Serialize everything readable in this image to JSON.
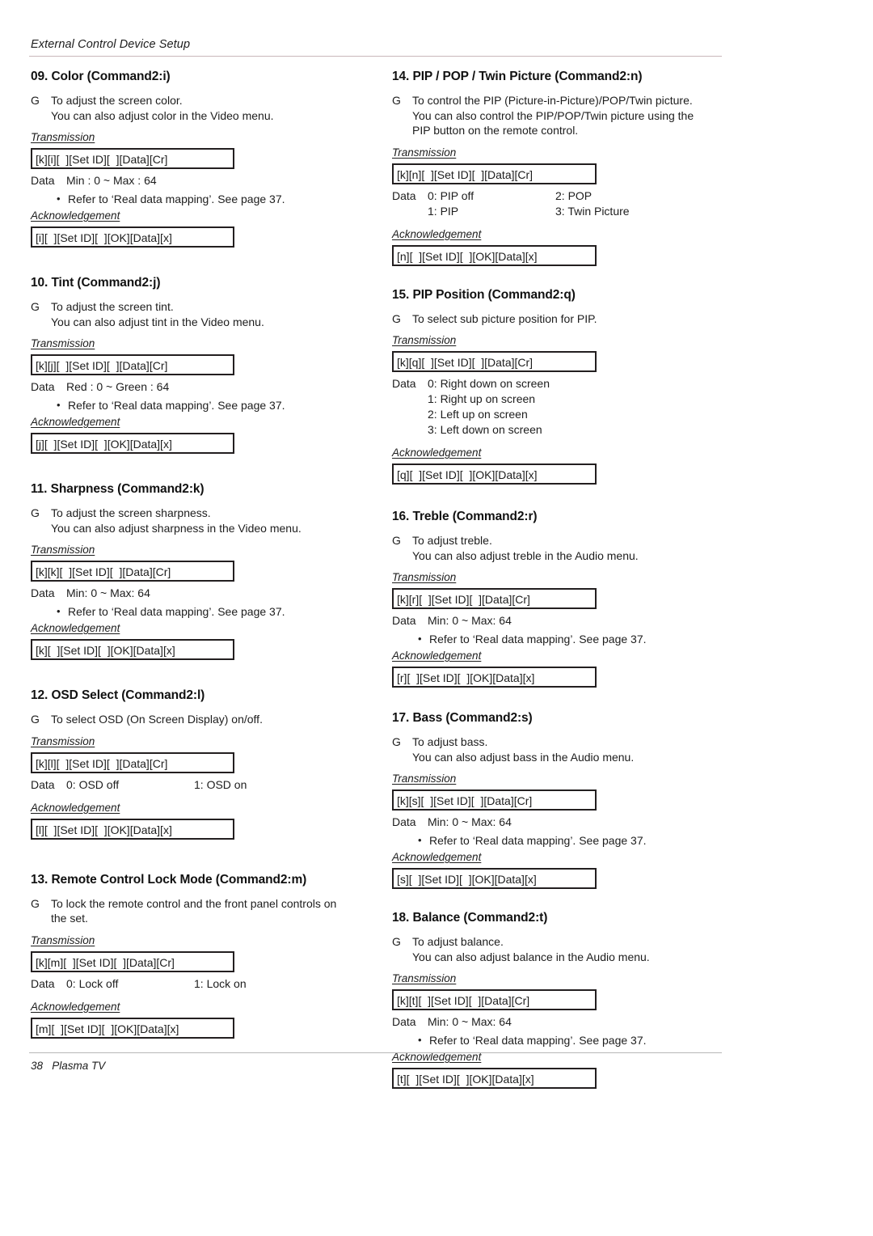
{
  "header": {
    "running_title": "External Control Device Setup"
  },
  "footer": {
    "page_number": "38",
    "product": "Plasma TV",
    "text": "38   Plasma TV"
  },
  "labels": {
    "transmission": "Transmission",
    "acknowledgement": "Acknowledgement",
    "data": "Data",
    "gmark": "G",
    "bullet": "•",
    "note_refer": "Refer to ‘Real data mapping’. See page 37."
  },
  "left_column": [
    {
      "id": "sec-09-color",
      "title": "09. Color (Command2:i)",
      "desc_lines": [
        "To adjust the screen color.",
        "You can also adjust color in the Video menu."
      ],
      "transmission": "[k][i][  ][Set ID][  ][Data][Cr]",
      "data_label": "Data",
      "data_values": [
        "Min : 0 ~ Max : 64"
      ],
      "data_values_col2": [],
      "note": "Refer to ‘Real data mapping’. See page 37.",
      "acknowledgement": "[i][  ][Set ID][  ][OK][Data][x]"
    },
    {
      "id": "sec-10-tint",
      "title": "10. Tint (Command2:j)",
      "desc_lines": [
        "To adjust the screen tint.",
        "You can also adjust tint in the Video menu."
      ],
      "transmission": "[k][j][  ][Set ID][  ][Data][Cr]",
      "data_label": "Data",
      "data_values": [
        "Red : 0 ~ Green : 64"
      ],
      "data_values_col2": [],
      "note": "Refer to ‘Real data mapping’. See page 37.",
      "acknowledgement": "[j][  ][Set ID][  ][OK][Data][x]"
    },
    {
      "id": "sec-11-sharpness",
      "title": "11. Sharpness (Command2:k)",
      "desc_lines": [
        "To adjust the screen sharpness.",
        "You can also adjust sharpness in the Video menu."
      ],
      "transmission": "[k][k][  ][Set ID][  ][Data][Cr]",
      "data_label": "Data",
      "data_values": [
        "Min: 0 ~ Max: 64"
      ],
      "data_values_col2": [],
      "note": "Refer to ‘Real data mapping’. See page 37.",
      "acknowledgement": "[k][  ][Set ID][  ][OK][Data][x]"
    },
    {
      "id": "sec-12-osd-select",
      "title": "12. OSD Select (Command2:l)",
      "desc_lines": [
        "To select OSD (On Screen Display) on/off."
      ],
      "transmission": "[k][l][  ][Set ID][  ][Data][Cr]",
      "data_label": "Data",
      "data_values": [
        "0: OSD off"
      ],
      "data_values_col2": [
        "1: OSD on"
      ],
      "note": "",
      "acknowledgement": "[l][  ][Set ID][  ][OK][Data][x]"
    },
    {
      "id": "sec-13-remote-lock",
      "title": "13. Remote Control Lock Mode (Command2:m)",
      "desc_lines": [
        "To lock the remote control and the front panel controls on",
        "the set."
      ],
      "transmission": "[k][m][  ][Set ID][  ][Data][Cr]",
      "data_label": "Data",
      "data_values": [
        "0: Lock off"
      ],
      "data_values_col2": [
        "1: Lock on"
      ],
      "note": "",
      "acknowledgement": "[m][  ][Set ID][  ][OK][Data][x]"
    }
  ],
  "right_column": [
    {
      "id": "sec-14-pip-pop-twin",
      "title": "14. PIP / POP / Twin Picture (Command2:n)",
      "desc_lines": [
        "To control the PIP (Picture-in-Picture)/POP/Twin picture.",
        "You can also control the PIP/POP/Twin picture using the",
        "PIP button on the remote control."
      ],
      "transmission": "[k][n][  ][Set ID][  ][Data][Cr]",
      "data_label": "Data",
      "data_values": [
        "0: PIP off",
        "1: PIP"
      ],
      "data_values_col2": [
        "2: POP",
        "3: Twin Picture"
      ],
      "note": "",
      "acknowledgement": "[n][  ][Set ID][  ][OK][Data][x]"
    },
    {
      "id": "sec-15-pip-position",
      "title": "15. PIP Position (Command2:q)",
      "desc_lines": [
        "To select sub picture position for PIP."
      ],
      "transmission": "[k][q][  ][Set ID][  ][Data][Cr]",
      "data_label": "Data",
      "data_values": [
        "0: Right down on screen",
        "1: Right up on screen",
        "2: Left up on screen",
        "3: Left down on screen"
      ],
      "data_values_col2": [],
      "note": "",
      "acknowledgement": "[q][  ][Set ID][  ][OK][Data][x]"
    },
    {
      "id": "sec-16-treble",
      "title": "16. Treble (Command2:r)",
      "desc_lines": [
        "To adjust treble.",
        "You can also adjust treble in the Audio menu."
      ],
      "transmission": "[k][r][  ][Set ID][  ][Data][Cr]",
      "data_label": "Data",
      "data_values": [
        "Min: 0 ~ Max: 64"
      ],
      "data_values_col2": [],
      "note": "Refer to ‘Real data mapping’. See page 37.",
      "acknowledgement": "[r][  ][Set ID][  ][OK][Data][x]"
    },
    {
      "id": "sec-17-bass",
      "title": "17. Bass (Command2:s)",
      "desc_lines": [
        "To adjust bass.",
        "You can also adjust bass in the Audio menu."
      ],
      "transmission": "[k][s][  ][Set ID][  ][Data][Cr]",
      "data_label": "Data",
      "data_values": [
        "Min: 0 ~ Max: 64"
      ],
      "data_values_col2": [],
      "note": "Refer to ‘Real data mapping’. See page 37.",
      "acknowledgement": "[s][  ][Set ID][  ][OK][Data][x]"
    },
    {
      "id": "sec-18-balance",
      "title": "18. Balance (Command2:t)",
      "desc_lines": [
        "To adjust balance.",
        "You can also adjust balance in the Audio menu."
      ],
      "transmission": "[k][t][  ][Set ID][  ][Data][Cr]",
      "data_label": "Data",
      "data_values": [
        "Min: 0 ~ Max: 64"
      ],
      "data_values_col2": [],
      "note": "Refer to ‘Real data mapping’. See page 37.",
      "acknowledgement": "[t][  ][Set ID][  ][OK][Data][x]"
    }
  ]
}
